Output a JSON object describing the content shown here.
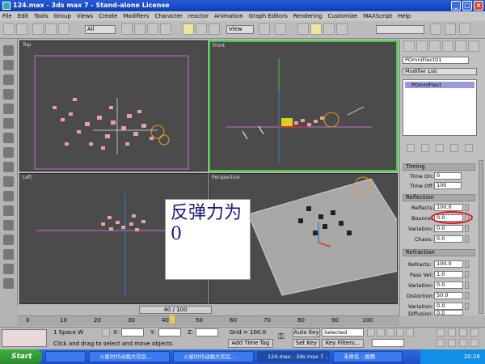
{
  "window": {
    "title": "124.max - 3ds max 7  -  Stand-alone License"
  },
  "menu": [
    "File",
    "Edit",
    "Tools",
    "Group",
    "Views",
    "Create",
    "Modifiers",
    "Character",
    "reactor",
    "Animation",
    "Graph Editors",
    "Rendering",
    "Customize",
    "MAXScript",
    "Help"
  ],
  "toolbar": {
    "selection_filter": "All",
    "ref_coord": "View"
  },
  "viewports": {
    "top": "Top",
    "front": "Front",
    "left": "Left",
    "perspective": "Perspective"
  },
  "annotation": {
    "text": "反弹力为0"
  },
  "panel": {
    "object_name": "POmniFlect01",
    "modifier_list": "Modifier List",
    "stack_item": "POmniFlect",
    "timing": {
      "header": "Timing",
      "time_on_label": "Time On:",
      "time_on": "0",
      "time_off_label": "Time Off:",
      "time_off": "100"
    },
    "reflection": {
      "header": "Reflection",
      "reflects_label": "Reflects:",
      "reflects": "100.0",
      "bounce_label": "Bounce:",
      "bounce": "0.0",
      "variation_label": "Variation:",
      "variation": "0.0",
      "chaos_label": "Chaos:",
      "chaos": "0.0"
    },
    "refraction": {
      "header": "Refraction",
      "refracts_label": "Refracts:",
      "refracts": "100.0",
      "passvel_label": "Pass Vel:",
      "passvel": "1.0",
      "variation_label": "Variation:",
      "variation": "0.0",
      "distortion_label": "Distortion:",
      "distortion": "50.0",
      "variation2_label": "Variation:",
      "variation2": "0.0",
      "diffusion_label": "Diffusion:",
      "diffusion": "0.0"
    }
  },
  "timeline": {
    "frame": "40 / 100",
    "ticks": [
      "0",
      "10",
      "20",
      "30",
      "40",
      "50",
      "60",
      "70",
      "80",
      "90",
      "100"
    ]
  },
  "status": {
    "selection": "1 Space W",
    "x_label": "X:",
    "y_label": "Y:",
    "z_label": "Z:",
    "grid": "Grid = 100.0",
    "prompt": "Click and drag to select and move objects",
    "add_time_tag": "Add Time Tag",
    "autokey": "Auto Key",
    "selected": "Selected",
    "setkey": "Set Key",
    "keyfilters": "Key Filters..."
  },
  "taskbar": {
    "start": "Start",
    "items": [
      "火星时代动画大社区...",
      "火星时代动画大社区...",
      "124.max - 3ds max 7 ...",
      "未命名 - 画图"
    ],
    "clock": "20:26"
  }
}
